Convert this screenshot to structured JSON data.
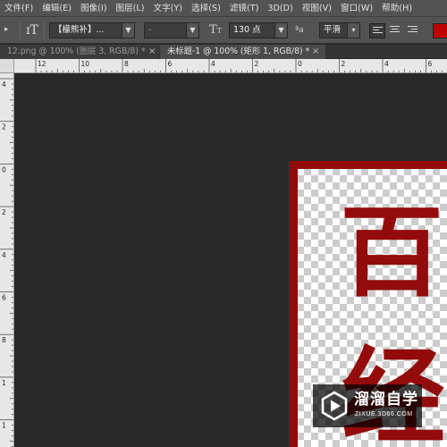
{
  "menu": [
    "文件(F)",
    "编辑(E)",
    "图像(I)",
    "图层(L)",
    "文字(Y)",
    "选择(S)",
    "滤镜(T)",
    "3D(D)",
    "视图(V)",
    "窗口(W)",
    "帮助(H)"
  ],
  "options_bar": {
    "tool_preset_icon": "type-tool-preset-icon",
    "vertical_type_icon": "vertical-type-toggle-icon",
    "font_family": "【檬熊补】...",
    "font_style": "-",
    "font_size_icon": "font-size-icon",
    "font_size": "130 点",
    "antialias_icon_text": "ªa",
    "antialias": "平滑",
    "align_left_icon": "align-left-icon",
    "align_center_icon": "align-center-icon",
    "align_right_icon": "align-right-icon",
    "text_color": "#c00000"
  },
  "tabs": [
    {
      "label": "12.png @ 100% (图层 3, RGB/8) *",
      "close": "×",
      "active": false
    },
    {
      "label": "未标题-1 @ 100% (矩形 1, RGB/8) *",
      "close": "×",
      "active": true
    }
  ],
  "rulers": {
    "horizontal_labels": [
      "12",
      "10",
      "8",
      "6",
      "4",
      "2",
      "0",
      "2",
      "4",
      "6"
    ],
    "vertical_labels": [
      "4",
      "2",
      "0",
      "2",
      "4",
      "6",
      "8",
      "1",
      "1"
    ]
  },
  "canvas": {
    "characters": [
      "百",
      "经"
    ],
    "frame_color": "#930b0b"
  },
  "watermark": {
    "title": "溜溜自学",
    "url": "ZIXUE.3D66.COM"
  }
}
